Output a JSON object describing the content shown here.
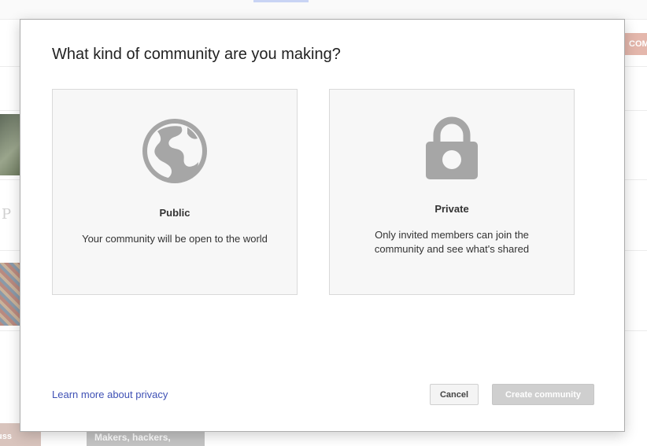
{
  "background": {
    "create_button_label": "COM",
    "chip_left_label": "uss",
    "chip_mid_label": "Makers, hackers,",
    "monogram": "P"
  },
  "dialog": {
    "title": "What kind of community are you making?",
    "options": [
      {
        "label": "Public",
        "description": "Your community will be open to the world",
        "icon": "globe-icon"
      },
      {
        "label": "Private",
        "description": "Only invited members can join the community and see what's shared",
        "icon": "lock-icon"
      }
    ],
    "privacy_link": "Learn more about privacy",
    "cancel_label": "Cancel",
    "create_label": "Create community"
  },
  "colors": {
    "link": "#3f51b5",
    "icon": "#a6a6a6",
    "disabled_button": "#cfcfcf"
  }
}
